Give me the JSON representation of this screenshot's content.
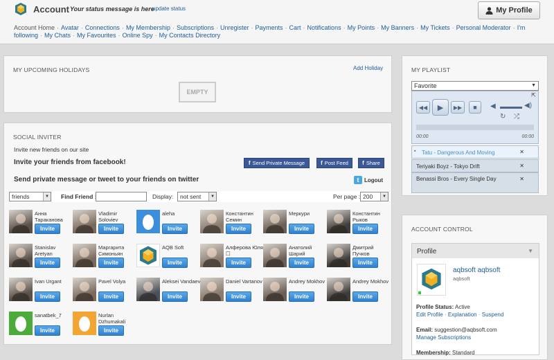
{
  "header": {
    "title": "Account",
    "status_message": "Your status message is here",
    "update_status": "update status",
    "my_profile": "My Profile"
  },
  "nav": [
    "Account Home",
    "Avatar",
    "Connections",
    "My Membership",
    "Subscriptions",
    "Unregister",
    "Payments",
    "Cart",
    "Notifications",
    "My Points",
    "My Banners",
    "My Tickets",
    "Personal Moderator",
    "I'm following",
    "My Chats",
    "My Favourites",
    "Online Spy",
    "My Contacts Directory"
  ],
  "holidays": {
    "title": "MY UPCOMING HOLIDAYS",
    "add": "Add Holiday",
    "empty": "EMPTY"
  },
  "inviter": {
    "title": "SOCIAL INVITER",
    "invite_text": "Invite new friends on our site",
    "facebook_heading": "Invite your friends from facebook!",
    "send_private_message": "Send Private Message",
    "post_feed": "Post Feed",
    "share": "Share",
    "twitter_heading": "Send private message or tweet to your friends on twitter",
    "logout": "Logout",
    "filter_select": "friends",
    "find_friend_label": "Find Friend :",
    "find_friend_value": "",
    "display_label": "Display:",
    "display_select": "not sent",
    "per_page_label": "Per page :",
    "per_page_select": "200",
    "invite_label": "Invite",
    "friends": [
      {
        "name": "Анна Тараканова",
        "pic": "photo"
      },
      {
        "name": "Vladimir Soloviev",
        "pic": "photo"
      },
      {
        "name": "aleha",
        "pic": "egg-blue"
      },
      {
        "name": "Константин Семин",
        "pic": "photo"
      },
      {
        "name": "Меркури",
        "pic": "photo"
      },
      {
        "name": "Константин Рыков",
        "pic": "photo"
      },
      {
        "name": "Stanislav Aretyan",
        "pic": "photo"
      },
      {
        "name": "Маргарита Симоньян",
        "pic": "photo"
      },
      {
        "name": "AQB Soft",
        "pic": "logo"
      },
      {
        "name": "Алферова Юля ☐",
        "pic": "photo"
      },
      {
        "name": "Анатолий Шарий",
        "pic": "photo"
      },
      {
        "name": "Дмитрий Пучков",
        "pic": "photo"
      },
      {
        "name": "Ivan Urgant",
        "pic": "photo"
      },
      {
        "name": "Pavel Volya",
        "pic": "photo"
      },
      {
        "name": "Aleksei Vandaev",
        "pic": "photo"
      },
      {
        "name": "Daniel Vartanov",
        "pic": "photo"
      },
      {
        "name": "Andrey Mokhov",
        "pic": "photo"
      },
      {
        "name": "Andrey Mokhov",
        "pic": "photo"
      },
      {
        "name": "sanatbek_7",
        "pic": "egg-green"
      },
      {
        "name": "Nurlan Dzhumakali",
        "pic": "egg-orange"
      }
    ]
  },
  "playlist": {
    "title": "MY PLAYLIST",
    "selected": "Favorite",
    "time_start": "00:00",
    "time_end": "00:00",
    "tracks": [
      "Tatu - Dangerous And Moving",
      "Teriyaki Boyz - Tokyo Drift",
      "Benassi Bros - Every Single Day"
    ]
  },
  "account_control": {
    "title": "ACCOUNT CONTROL",
    "tab": "Profile",
    "name": "aqbsoft aqbsoft",
    "username": "aqbsoft",
    "status_label": "Profile Status:",
    "status_value": "Active",
    "edit_profile": "Edit Profile",
    "explanation": "Explanation",
    "suspend": "Suspend",
    "email_label": "Email:",
    "email_value": "suggestion@aqbsoft.com",
    "manage_subscriptions": "Manage Subscriptions",
    "membership_label": "Membership:",
    "membership_value": "Standard"
  },
  "colors": {
    "link": "#1e5c9b",
    "invite_button": "#3a8ad8",
    "facebook": "#3b5998"
  }
}
